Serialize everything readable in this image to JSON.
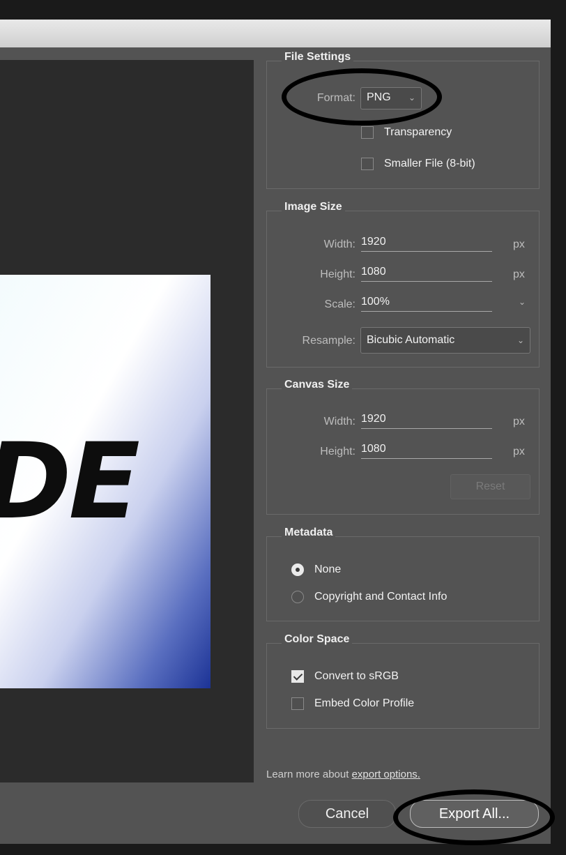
{
  "preview": {
    "text": "DE"
  },
  "file_settings": {
    "title": "File Settings",
    "format_label": "Format:",
    "format_value": "PNG",
    "transparency_label": "Transparency",
    "transparency_checked": false,
    "smaller_file_label": "Smaller File (8-bit)",
    "smaller_file_checked": false
  },
  "image_size": {
    "title": "Image Size",
    "width_label": "Width:",
    "width_value": "1920",
    "width_unit": "px",
    "height_label": "Height:",
    "height_value": "1080",
    "height_unit": "px",
    "scale_label": "Scale:",
    "scale_value": "100%",
    "resample_label": "Resample:",
    "resample_value": "Bicubic Automatic"
  },
  "canvas_size": {
    "title": "Canvas Size",
    "width_label": "Width:",
    "width_value": "1920",
    "width_unit": "px",
    "height_label": "Height:",
    "height_value": "1080",
    "height_unit": "px",
    "reset_label": "Reset"
  },
  "metadata": {
    "title": "Metadata",
    "none_label": "None",
    "copyright_label": "Copyright and Contact Info",
    "selected": "None"
  },
  "color_space": {
    "title": "Color Space",
    "convert_label": "Convert to sRGB",
    "convert_checked": true,
    "embed_label": "Embed Color Profile",
    "embed_checked": false
  },
  "footer": {
    "learn_more_text": "Learn more about ",
    "learn_more_link": "export options.",
    "cancel_label": "Cancel",
    "export_label": "Export All..."
  },
  "colors": {
    "dialog_bg": "#535353",
    "preview_bg": "#2b2b2b",
    "annotation_ring": "#000000"
  }
}
